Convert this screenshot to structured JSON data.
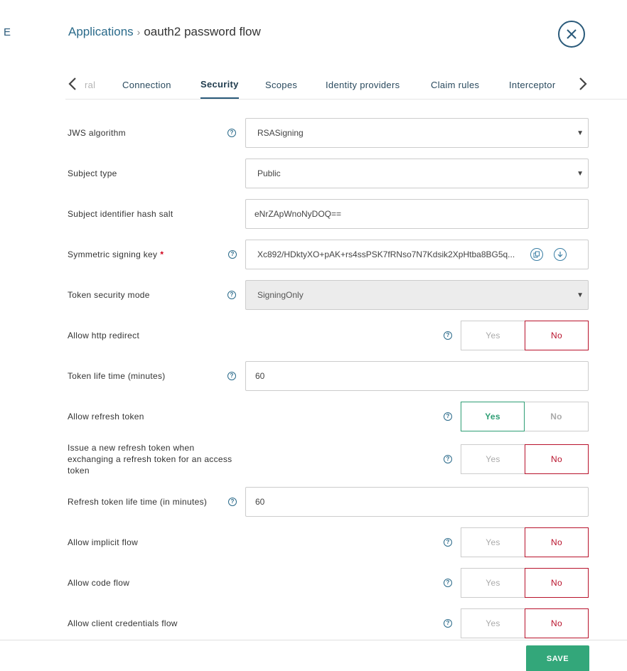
{
  "left_edge_letter": "E",
  "breadcrumb": {
    "parent": "Applications",
    "separator": "›",
    "current": "oauth2 password flow"
  },
  "tabs": [
    {
      "label": "ral"
    },
    {
      "label": "Connection"
    },
    {
      "label": "Security"
    },
    {
      "label": "Scopes"
    },
    {
      "label": "Identity providers"
    },
    {
      "label": "Claim rules"
    },
    {
      "label": "Interceptor"
    }
  ],
  "help_glyph": "?",
  "toggle_labels": {
    "yes": "Yes",
    "no": "No"
  },
  "fields": {
    "jws_algorithm": {
      "label": "JWS algorithm",
      "value": "RSASigning"
    },
    "subject_type": {
      "label": "Subject type",
      "value": "Public"
    },
    "subject_hash_salt": {
      "label": "Subject identifier hash salt",
      "value": "eNrZApWnoNyDOQ=="
    },
    "symmetric_signing_key": {
      "label": "Symmetric signing key",
      "required": "*",
      "value": "Xc892/HDktyXO+pAK+rs4ssPSK7fRNso7N7Kdsik2XpHtba8BG5q..."
    },
    "token_security_mode": {
      "label": "Token security mode",
      "value": "SigningOnly"
    },
    "allow_http_redirect": {
      "label": "Allow http redirect",
      "selected": "No"
    },
    "token_life_time": {
      "label": "Token life time (minutes)",
      "value": "60"
    },
    "allow_refresh_token": {
      "label": "Allow refresh token",
      "selected": "Yes"
    },
    "issue_new_refresh_token": {
      "label": "Issue a new refresh token when exchanging a refresh token for an access token",
      "selected": "No"
    },
    "refresh_token_life_time": {
      "label": "Refresh token life time (in minutes)",
      "value": "60"
    },
    "allow_implicit_flow": {
      "label": "Allow implicit flow",
      "selected": "No"
    },
    "allow_code_flow": {
      "label": "Allow code flow",
      "selected": "No"
    },
    "allow_client_credentials_flow": {
      "label": "Allow client credentials flow",
      "selected": "No"
    }
  },
  "footer": {
    "save_label": "SAVE"
  },
  "colors": {
    "accent": "#2a5a7a",
    "yes_selected": "#2e9e74",
    "no_selected": "#b8122b",
    "save": "#33a77a"
  }
}
